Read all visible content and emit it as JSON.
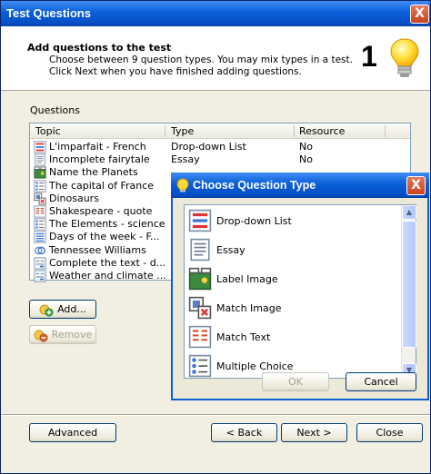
{
  "window": {
    "title": "Test Questions",
    "close_glyph": "X"
  },
  "header": {
    "heading": "Add questions to the test",
    "line1": "Choose between 9 question types. You may mix types in a test.",
    "line2": "Click Next when you have finished adding questions.",
    "step_number": "1",
    "icon": "lightbulb-icon"
  },
  "questions": {
    "label": "Questions",
    "columns": [
      "Topic",
      "Type",
      "Resource"
    ],
    "rows": [
      {
        "topic": "L'imparfait - French",
        "type": "Drop-down List",
        "resource": "No",
        "icon": "drop-down-list-icon"
      },
      {
        "topic": "Incomplete fairytale",
        "type": "Essay",
        "resource": "No",
        "icon": "essay-icon"
      },
      {
        "topic": "Name the Planets",
        "type": "",
        "resource": "",
        "icon": "label-image-icon"
      },
      {
        "topic": "The capital of France",
        "type": "",
        "resource": "",
        "icon": "multiple-choice-icon"
      },
      {
        "topic": "Dinosaurs",
        "type": "",
        "resource": "",
        "icon": "match-image-icon"
      },
      {
        "topic": "Shakespeare - quote",
        "type": "",
        "resource": "",
        "icon": "match-text-icon"
      },
      {
        "topic": "The Elements - science",
        "type": "",
        "resource": "",
        "icon": "multiple-choice-icon"
      },
      {
        "topic": "Days of the week - F...",
        "type": "",
        "resource": "",
        "icon": "ordering-icon"
      },
      {
        "topic": "Tennessee Williams",
        "type": "",
        "resource": "",
        "icon": "link-icon"
      },
      {
        "topic": "Complete the text - d...",
        "type": "",
        "resource": "",
        "icon": "complete-text-icon"
      },
      {
        "topic": "Weather and climate ...",
        "type": "",
        "resource": "",
        "icon": "complete-text-icon"
      }
    ]
  },
  "buttons": {
    "add": "Add...",
    "remove": "Remove",
    "advanced": "Advanced",
    "back": "< Back",
    "next": "Next >",
    "close": "Close"
  },
  "dialog": {
    "title": "Choose Question Type",
    "close_glyph": "X",
    "items": [
      {
        "label": "Drop-down List",
        "icon": "drop-down-list-icon"
      },
      {
        "label": "Essay",
        "icon": "essay-icon"
      },
      {
        "label": "Label Image",
        "icon": "label-image-icon"
      },
      {
        "label": "Match Image",
        "icon": "match-image-icon"
      },
      {
        "label": "Match Text",
        "icon": "match-text-icon"
      },
      {
        "label": "Multiple Choice",
        "icon": "multiple-choice-icon"
      }
    ],
    "ok": "OK",
    "cancel": "Cancel"
  },
  "colors": {
    "titlebar_blue": "#0a5fd8",
    "window_bg": "#f1efe2",
    "close_red": "#c8411e"
  }
}
